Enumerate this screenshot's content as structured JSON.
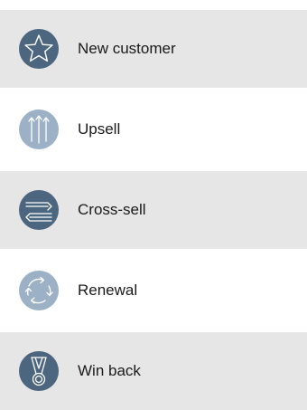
{
  "items": [
    {
      "label": "New customer",
      "icon": "star-icon",
      "style": "dark"
    },
    {
      "label": "Upsell",
      "icon": "arrows-up-icon",
      "style": "light"
    },
    {
      "label": "Cross-sell",
      "icon": "cross-arrows-icon",
      "style": "dark"
    },
    {
      "label": "Renewal",
      "icon": "cycle-icon",
      "style": "light"
    },
    {
      "label": "Win back",
      "icon": "medal-icon",
      "style": "dark"
    }
  ],
  "colors": {
    "dark_icon": "#4d6680",
    "light_icon": "#9cb1c6",
    "row_shaded": "#e6e6e6",
    "row_plain": "#ffffff"
  }
}
